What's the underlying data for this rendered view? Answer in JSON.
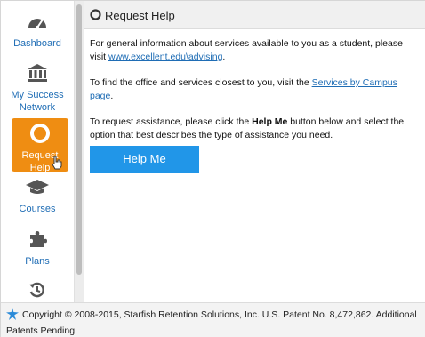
{
  "sidebar": {
    "items": [
      {
        "label": "Dashboard",
        "icon": "dashboard-icon"
      },
      {
        "label": "My Success\nNetwork",
        "label_line1": "My Success",
        "label_line2": "Network",
        "icon": "bank-icon"
      },
      {
        "label_line1": "Request",
        "label_line2": "Help",
        "icon": "lifebuoy-icon",
        "active": true
      },
      {
        "label": "Courses",
        "icon": "graduation-cap-icon"
      },
      {
        "label": "Plans",
        "icon": "puzzle-icon"
      },
      {
        "label": "",
        "icon": "history-icon"
      }
    ]
  },
  "panel": {
    "title": "Request Help",
    "para1_text": "For general information about services available to you as a student, please visit ",
    "para1_link": "www.excellent.edu\\advising",
    "para1_end": ".",
    "para2_text": "To find the office and services closest to you, visit the ",
    "para2_link": "Services by Campus page",
    "para2_end": ".",
    "para3_pre": "To request assistance, please click the ",
    "para3_bold": "Help Me",
    "para3_post": " button below and select the option that best describes the type of assistance you need.",
    "button_label": "Help Me"
  },
  "footer": {
    "text": "Copyright © 2008-2015, Starfish Retention Solutions, Inc. U.S. Patent No. 8,472,862. Additional Patents Pending."
  },
  "colors": {
    "accent": "#ef8d12",
    "link": "#1f6db5",
    "button": "#2196e8"
  }
}
